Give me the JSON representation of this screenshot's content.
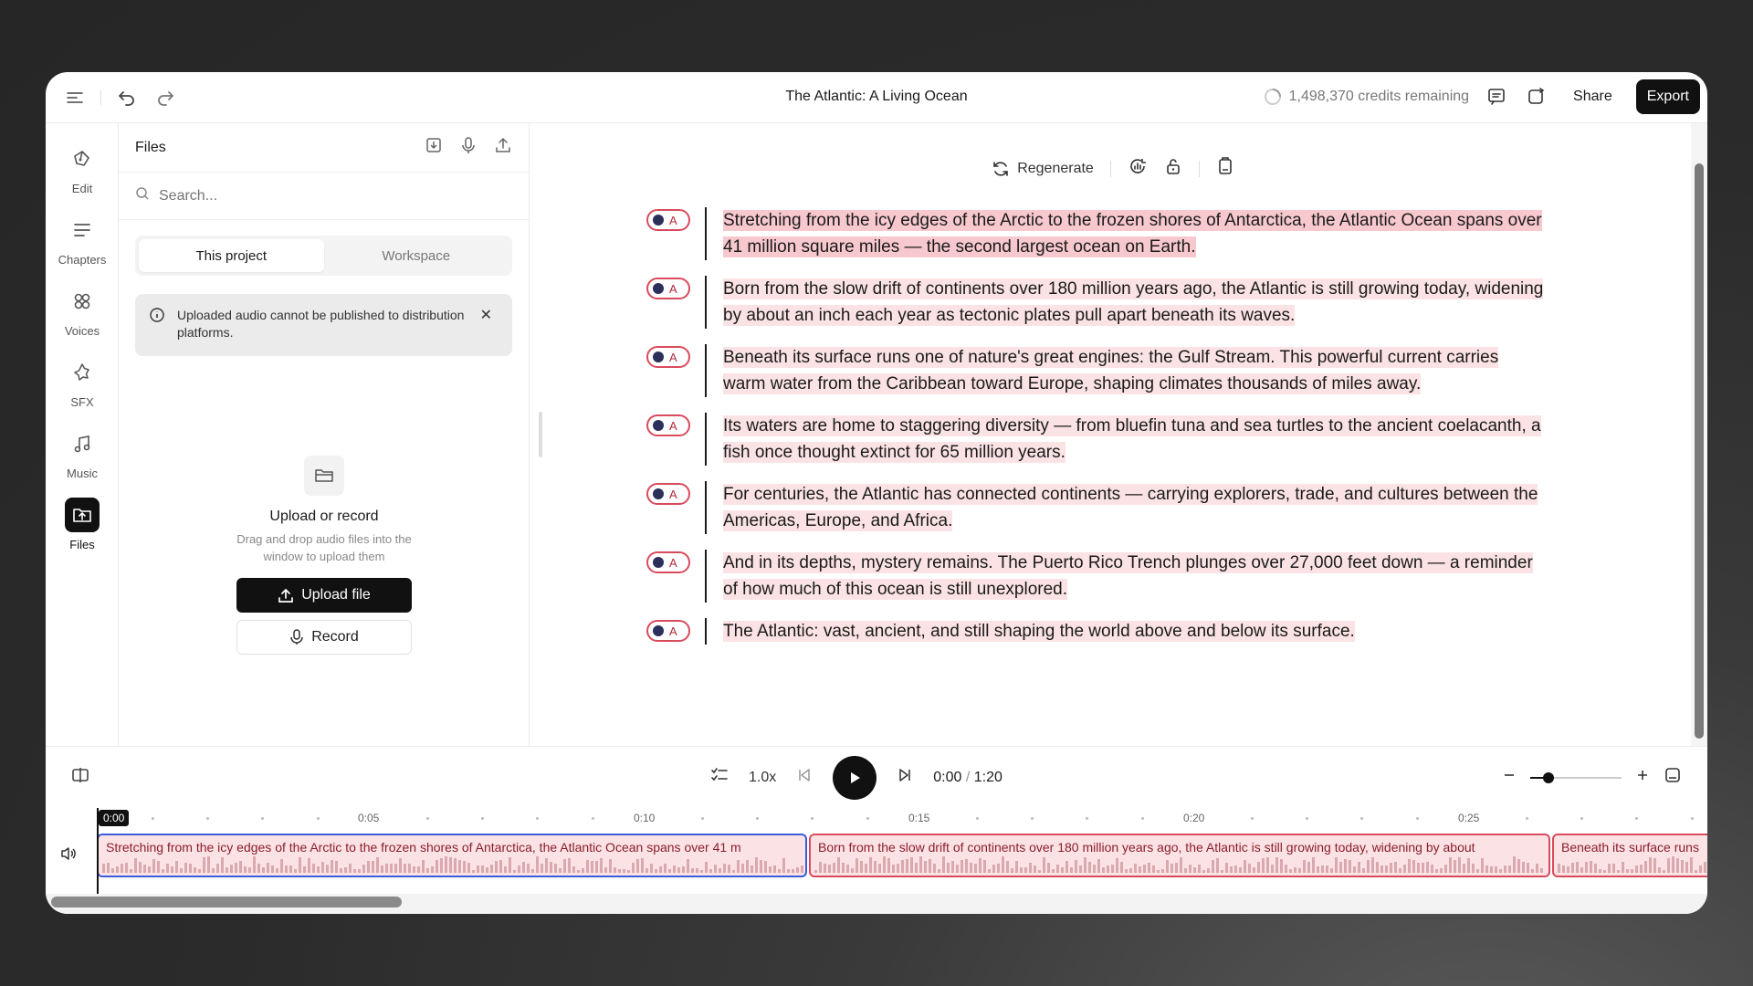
{
  "topbar": {
    "title": "The Atlantic: A Living Ocean",
    "credits": "1,498,370 credits remaining",
    "share_label": "Share",
    "export_label": "Export"
  },
  "rail": {
    "items": [
      {
        "label": "Edit",
        "icon": "pen-tool-icon"
      },
      {
        "label": "Chapters",
        "icon": "chapters-icon"
      },
      {
        "label": "Voices",
        "icon": "voices-icon"
      },
      {
        "label": "SFX",
        "icon": "sfx-icon"
      },
      {
        "label": "Music",
        "icon": "music-icon"
      },
      {
        "label": "Files",
        "icon": "files-icon"
      }
    ]
  },
  "files": {
    "title": "Files",
    "search_placeholder": "Search...",
    "tabs": [
      "This project",
      "Workspace"
    ],
    "notice": "Uploaded audio cannot be published to distribution platforms.",
    "upload_title": "Upload or record",
    "upload_sub": "Drag and drop audio files into the window to upload them",
    "upload_button": "Upload file",
    "record_button": "Record"
  },
  "editor": {
    "regenerate_label": "Regenerate",
    "voice_label": "A",
    "paragraphs": [
      "Stretching from the icy edges of the Arctic to the frozen shores of Antarctica, the Atlantic Ocean spans over 41 million square miles — the second largest ocean on Earth.",
      "Born from the slow drift of continents over 180 million years ago, the Atlantic is still growing today, widening by about an inch each year as tectonic plates pull apart beneath its waves.",
      "Beneath its surface runs one of nature's great engines: the Gulf Stream. This powerful current carries warm water from the Caribbean toward Europe, shaping climates thousands of miles away.",
      "Its waters are home to staggering diversity — from bluefin tuna and sea turtles to the ancient coelacanth, a fish once thought extinct for 65 million years.",
      "For centuries, the Atlantic has connected continents — carrying explorers, trade, and cultures between the Americas, Europe, and Africa.",
      "And in its depths, mystery remains. The Puerto Rico Trench plunges over 27,000 feet down — a reminder of how much of this ocean is still unexplored.",
      "The Atlantic: vast, ancient, and still shaping the world above and below its surface."
    ]
  },
  "player": {
    "speed": "1.0x",
    "current_time": "0:00",
    "separator": "/",
    "total_time": "1:20",
    "zoom_level": 0.2
  },
  "timeline": {
    "playhead": "0:00",
    "ticks": [
      "0:05",
      "0:10",
      "0:15",
      "0:20",
      "0:25"
    ],
    "clips": [
      "Stretching from the icy edges of the Arctic to the frozen shores of Antarctica, the Atlantic Ocean spans over 41 m",
      "Born from the slow drift of continents over 180 million years ago, the Atlantic is still growing today, widening by about",
      "Beneath its surface runs"
    ]
  },
  "colors": {
    "accent": "#111111",
    "highlight": "#fbe3e5",
    "clip_border": "#d94b5c",
    "selected_border": "#3b5bdb"
  }
}
